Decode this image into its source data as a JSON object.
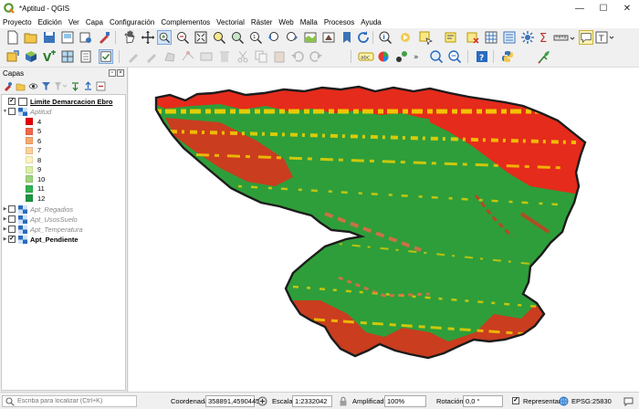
{
  "window": {
    "title": "*Aptitud - QGIS",
    "minimize": "—",
    "maximize": "☐",
    "close": "✕"
  },
  "menu": [
    "Proyecto",
    "Edición",
    "Ver",
    "Capa",
    "Configuración",
    "Complementos",
    "Vectorial",
    "Ráster",
    "Web",
    "Malla",
    "Procesos",
    "Ayuda"
  ],
  "layers_panel": {
    "title": "Capas",
    "layers": [
      {
        "name": "Limite Demarcacion Ebro",
        "checked": true,
        "style": "bold-underline",
        "expanded": false
      },
      {
        "name": "Aptitud",
        "checked": false,
        "style": "italic",
        "expanded": true,
        "legend": [
          {
            "label": "4",
            "color": "#e60000"
          },
          {
            "label": "5",
            "color": "#f26649"
          },
          {
            "label": "6",
            "color": "#f8a86e"
          },
          {
            "label": "7",
            "color": "#fcd196"
          },
          {
            "label": "8",
            "color": "#fff3be"
          },
          {
            "label": "9",
            "color": "#ddf0a5"
          },
          {
            "label": "10",
            "color": "#9ed57c"
          },
          {
            "label": "11",
            "color": "#30b351"
          },
          {
            "label": "12",
            "color": "#1a9641"
          }
        ]
      },
      {
        "name": "Apt_Regadios",
        "checked": false,
        "style": "italic",
        "expanded": false
      },
      {
        "name": "Apt_UsosSuelo",
        "checked": false,
        "style": "italic",
        "expanded": false
      },
      {
        "name": "Apt_Temperatura",
        "checked": false,
        "style": "italic",
        "expanded": false
      },
      {
        "name": "Apt_Pendiente",
        "checked": true,
        "style": "bold",
        "expanded": false
      }
    ]
  },
  "statusbar": {
    "locator_placeholder": "Escriba para localizar (Ctrl+K)",
    "coord_label": "Coordenada",
    "coord_value": "358891,4590445",
    "scale_label": "Escala",
    "scale_value": "1:2332042",
    "magnifier_label": "Amplificador",
    "magnifier_value": "100%",
    "rotation_label": "Rotación",
    "rotation_value": "0,0 °",
    "render_label": "Representar",
    "crs_label": "EPSG:25830"
  },
  "colors": {
    "accent_green": "#2e9e3a",
    "raster_red": "#e52b1b",
    "raster_yellow": "#f5d300",
    "toolbar_bg": "#f0f0f0"
  }
}
